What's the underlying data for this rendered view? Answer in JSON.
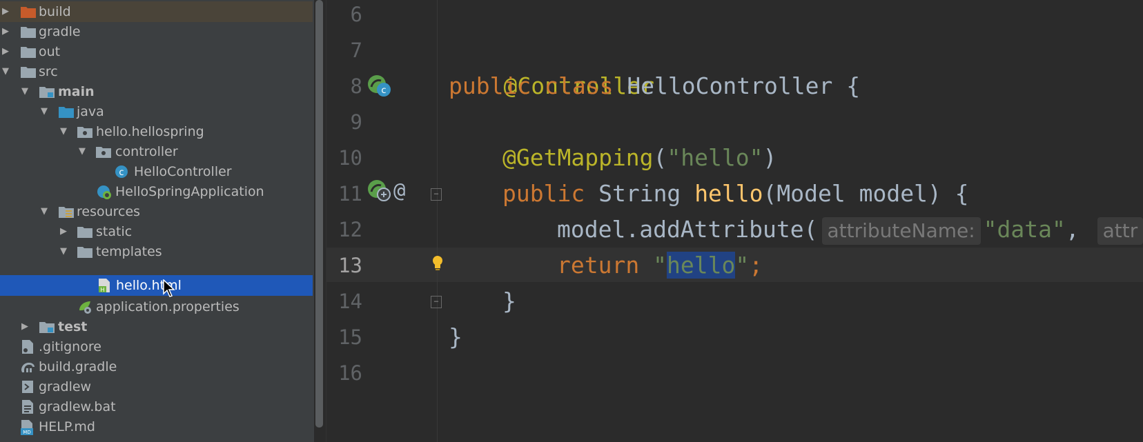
{
  "tree": {
    "items": [
      {
        "label": "build"
      },
      {
        "label": "gradle"
      },
      {
        "label": "out"
      },
      {
        "label": "src"
      },
      {
        "label": "main"
      },
      {
        "label": "java"
      },
      {
        "label": "hello.hellospring"
      },
      {
        "label": "controller"
      },
      {
        "label": "HelloController"
      },
      {
        "label": "HelloSpringApplication"
      },
      {
        "label": "resources"
      },
      {
        "label": "static"
      },
      {
        "label": "templates"
      },
      {
        "label": "hello.html"
      },
      {
        "label": "application.properties"
      },
      {
        "label": "test"
      },
      {
        "label": ".gitignore"
      },
      {
        "label": "build.gradle"
      },
      {
        "label": "gradlew"
      },
      {
        "label": "gradlew.bat"
      },
      {
        "label": "HELP.md"
      }
    ]
  },
  "editor": {
    "line_numbers": [
      "6",
      "7",
      "8",
      "9",
      "10",
      "11",
      "12",
      "13",
      "14",
      "15",
      "16"
    ],
    "current_line": "13",
    "code": {
      "l7_annotation": "@Controller",
      "l8_public": "public",
      "l8_class": "class",
      "l8_name": "HelloController {",
      "l10_annotation": "@GetMapping",
      "l10_open": "(",
      "l10_str": "\"hello\"",
      "l10_close": ")",
      "l11_public": "public",
      "l11_type": "String",
      "l11_method": "hello",
      "l11_params": "(Model model) {",
      "l12_call": "model.addAttribute(",
      "l12_hint1": "attributeName:",
      "l12_str": "\"data\"",
      "l12_comma": ",",
      "l12_hint2": "attr",
      "l13_return": "return",
      "l13_q1": "\"",
      "l13_sel": "hello",
      "l13_q2": "\"",
      "l13_semi": ";",
      "l14_brace": "}",
      "l15_brace": "}"
    },
    "gutter_at_symbol": "@"
  },
  "colors": {
    "selection": "#1f58b8",
    "annotation": "#bbb529",
    "keyword": "#cc7832",
    "string": "#6a8759",
    "method": "#ffc66d"
  }
}
